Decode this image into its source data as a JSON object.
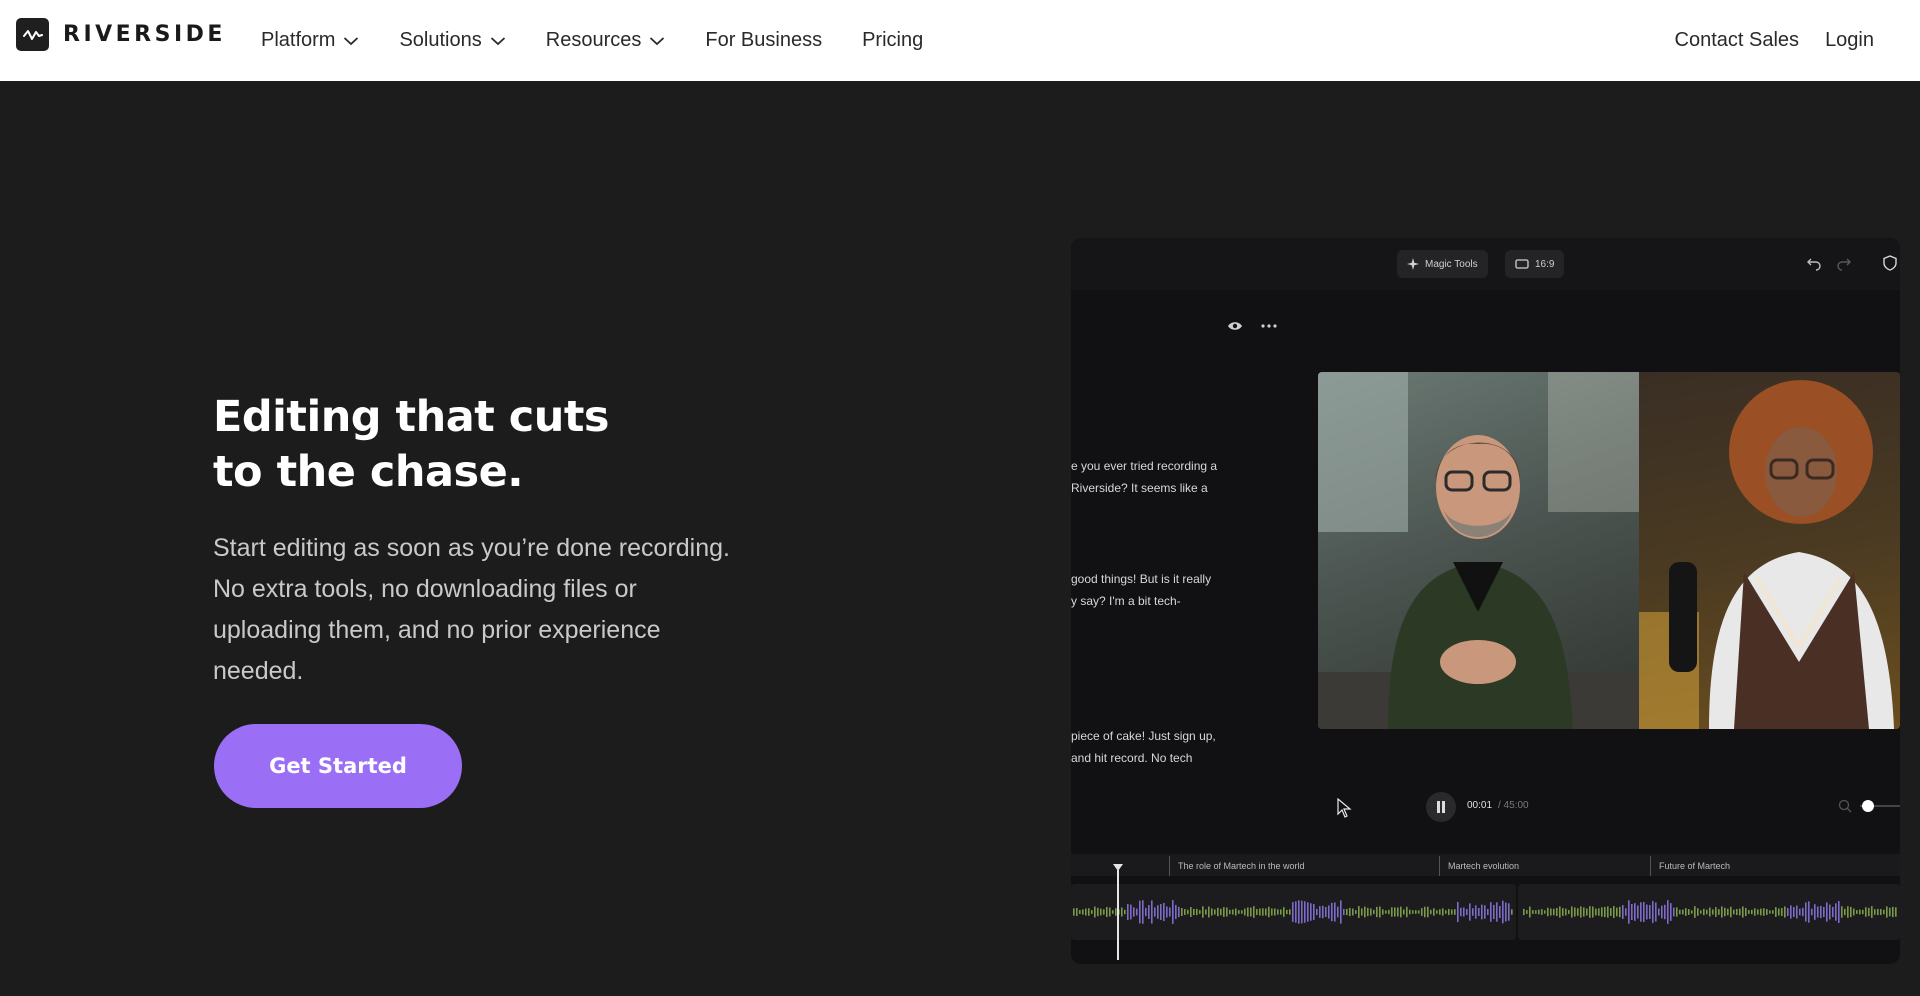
{
  "brand": {
    "name": "RIVERSIDE"
  },
  "nav": {
    "items": [
      {
        "label": "Platform",
        "dropdown": true
      },
      {
        "label": "Solutions",
        "dropdown": true
      },
      {
        "label": "Resources",
        "dropdown": true
      },
      {
        "label": "For Business",
        "dropdown": false
      },
      {
        "label": "Pricing",
        "dropdown": false
      }
    ],
    "contact_sales": "Contact Sales",
    "login": "Login"
  },
  "hero": {
    "headline_line1": "Editing that cuts",
    "headline_line2": "to the chase.",
    "subtext": "Start editing as soon as you’re done recording. No extra tools, no downloading files or uploading them, and no prior experience needed.",
    "cta": "Get Started"
  },
  "editor": {
    "magic_tools": "Magic Tools",
    "aspect_ratio": "16:9",
    "transcript": [
      "e you ever tried recording a",
      "Riverside? It seems like a",
      "good things! But is it really",
      "y say? I'm a bit tech-",
      "piece of cake! Just sign up,",
      "and hit record. No tech"
    ],
    "time_current": "00:01",
    "time_total": "/ 45:00",
    "chapters": [
      "The role of Martech in the world",
      "Martech evolution",
      "Future of Martech"
    ]
  },
  "colors": {
    "accent": "#9a6ff5",
    "background": "#1c1c1d",
    "nav_background": "#ffffff",
    "waveform_green": "#7a9a4a",
    "waveform_purple": "#7e6bc9"
  }
}
